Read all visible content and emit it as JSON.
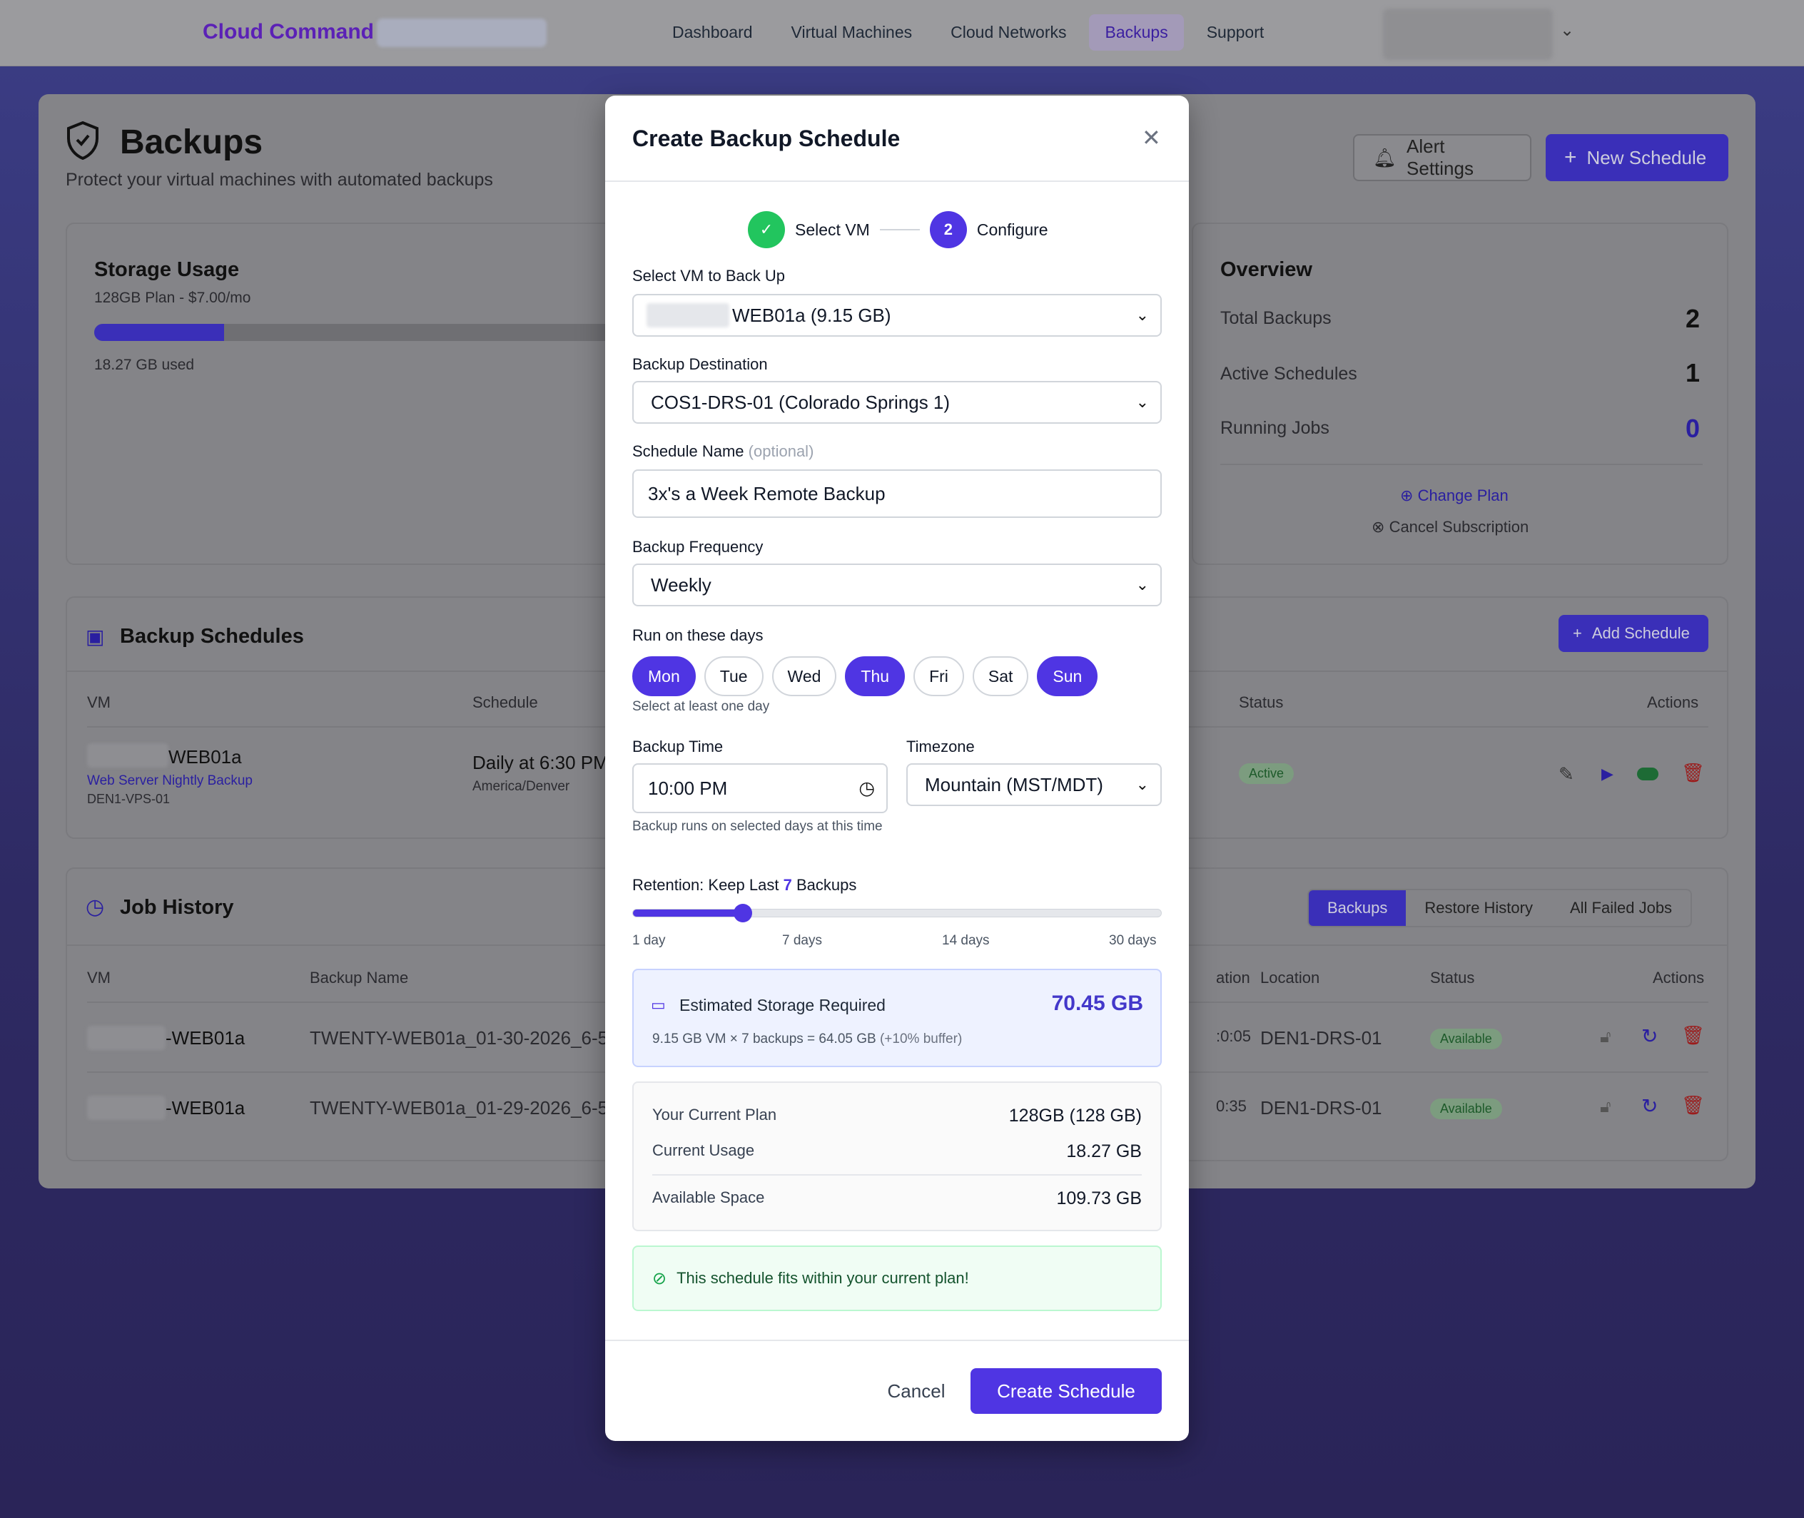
{
  "nav": {
    "brand": "Cloud Command",
    "links": [
      "Dashboard",
      "Virtual Machines",
      "Cloud Networks",
      "Backups",
      "Support"
    ],
    "active": "Backups"
  },
  "page": {
    "title": "Backups",
    "subtitle": "Protect your virtual machines with automated backups",
    "alert_settings": "Alert Settings",
    "new_schedule": "New Schedule",
    "storage": {
      "title": "Storage Usage",
      "plan": "128GB Plan - $7.00/mo",
      "used": "18.27 GB used",
      "used_fraction": 0.14
    },
    "overview": {
      "title": "Overview",
      "rows": [
        {
          "label": "Total Backups",
          "value": "2"
        },
        {
          "label": "Active Schedules",
          "value": "1"
        },
        {
          "label": "Running Jobs",
          "value": "0"
        }
      ],
      "change_plan": "Change Plan",
      "cancel_subscription": "Cancel Subscription"
    },
    "schedules": {
      "title": "Backup Schedules",
      "add": "Add Schedule",
      "headers": {
        "vm": "VM",
        "schedule": "Schedule",
        "status": "Status",
        "actions": "Actions"
      },
      "row": {
        "vm": "WEB01a",
        "name": "Web Server Nightly Backup",
        "location": "DEN1-VPS-01",
        "schedule": "Daily at 6:30 PM",
        "tz": "America/Denver",
        "status": "Active"
      }
    },
    "jobs": {
      "title": "Job History",
      "tabs": [
        "Backups",
        "Restore History",
        "All Failed Jobs"
      ],
      "headers": {
        "vm": "VM",
        "name": "Backup Name",
        "duration": "ation",
        "location": "Location",
        "status": "Status",
        "actions": "Actions"
      },
      "rows": [
        {
          "vm": "-WEB01a",
          "name": "TWENTY-WEB01a_01-30-2026_6-5",
          "duration": ":0:05",
          "location": "DEN1-DRS-01",
          "status": "Available"
        },
        {
          "vm": "-WEB01a",
          "name": "TWENTY-WEB01a_01-29-2026_6-5",
          "duration": "0:35",
          "location": "DEN1-DRS-01",
          "status": "Available"
        }
      ]
    }
  },
  "modal": {
    "title": "Create Backup Schedule",
    "steps": [
      {
        "label": "Select VM",
        "state": "done"
      },
      {
        "number": "2",
        "label": "Configure",
        "state": "current"
      }
    ],
    "vm_label": "Select VM to Back Up",
    "vm_value": "WEB01a (9.15 GB)",
    "dest_label": "Backup Destination",
    "dest_value": "COS1-DRS-01 (Colorado Springs 1)",
    "name_label": "Schedule Name",
    "name_optional": "(optional)",
    "name_value": "3x's a Week Remote Backup",
    "freq_label": "Backup Frequency",
    "freq_value": "Weekly",
    "days_label": "Run on these days",
    "days": [
      {
        "label": "Mon",
        "on": true
      },
      {
        "label": "Tue",
        "on": false
      },
      {
        "label": "Wed",
        "on": false
      },
      {
        "label": "Thu",
        "on": true
      },
      {
        "label": "Fri",
        "on": false
      },
      {
        "label": "Sat",
        "on": false
      },
      {
        "label": "Sun",
        "on": true
      }
    ],
    "days_hint": "Select at least one day",
    "time_label": "Backup Time",
    "time_value": "10:00 PM",
    "time_hint": "Backup runs on selected days at this time",
    "tz_label": "Timezone",
    "tz_value": "Mountain (MST/MDT)",
    "retention_prefix": "Retention: Keep Last",
    "retention_value": "7",
    "retention_suffix": "Backups",
    "retention_min": 1,
    "retention_max": 30,
    "retention_ticks": [
      "1 day",
      "7 days",
      "14 days",
      "30 days"
    ],
    "estimate_label": "Estimated Storage Required",
    "estimate_value": "70.45 GB",
    "estimate_formula": "9.15 GB VM × 7 backups = 64.05 GB",
    "estimate_buffer": "(+10% buffer)",
    "plan_rows": [
      {
        "label": "Your Current Plan",
        "value": "128GB (128 GB)"
      },
      {
        "label": "Current Usage",
        "value": "18.27 GB"
      },
      {
        "label": "Available Space",
        "value": "109.73 GB"
      }
    ],
    "fits_message": "This schedule fits within your current plan!",
    "cancel": "Cancel",
    "create": "Create Schedule"
  },
  "colors": {
    "accent": "#4f35e3",
    "success": "#22c55e",
    "brand": "#5b21b6"
  }
}
